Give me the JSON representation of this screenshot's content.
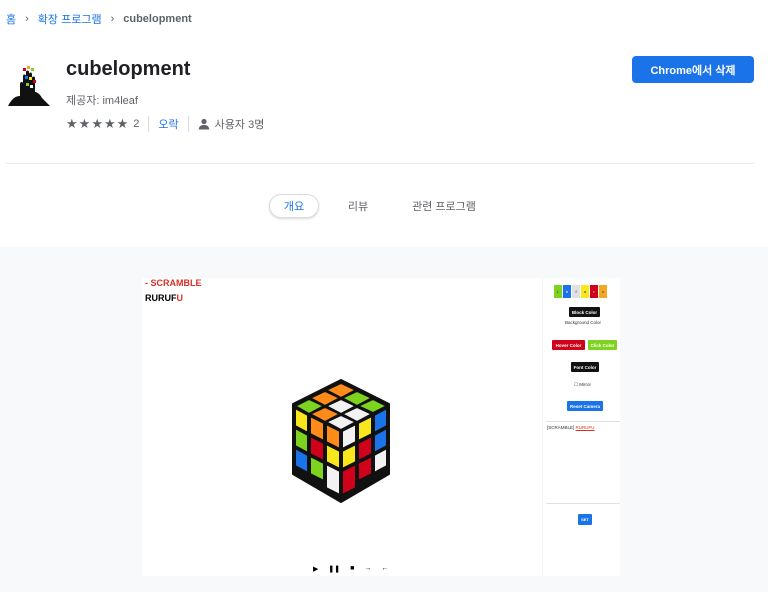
{
  "breadcrumb": {
    "home": "홈",
    "extensions": "확장 프로그램",
    "current": "cubelopment",
    "separator": "›"
  },
  "app": {
    "title": "cubelopment",
    "publisher": "제공자: im4leaf",
    "rating_stars": 5,
    "rating_count": "2",
    "category": "오락",
    "users": "사용자 3명",
    "remove_button": "Chrome에서 삭제"
  },
  "tabs": [
    {
      "label": "개요",
      "active": true
    },
    {
      "label": "리뷰",
      "active": false
    },
    {
      "label": "관련 프로그램",
      "active": false
    }
  ],
  "screenshot": {
    "scramble_title": "- SCRAMBLE",
    "moves_prefix": "RURUF",
    "moves_last": "U",
    "controls": [
      "▶",
      "❚❚",
      "■",
      "→",
      "←"
    ],
    "panel": {
      "swatches": [
        {
          "label": "L",
          "color": "#7ed321"
        },
        {
          "label": "b",
          "color": "#1a73e8"
        },
        {
          "label": "f",
          "color": "#e0e0e0"
        },
        {
          "label": "a",
          "color": "#f8e71c"
        },
        {
          "label": "r",
          "color": "#d0021b"
        },
        {
          "label": "o",
          "color": "#f5a623"
        }
      ],
      "block_color": "Block Color",
      "background_color": "Background Color",
      "hover_color": "Hover Color",
      "click_color": "Click Color",
      "font_color": "Font Color",
      "mirror": "☐ Mirror",
      "reset_camera": "Reset Camera",
      "scramble_text": "[SCRAMBLE]",
      "scramble_moves": "RURUFU",
      "set_button": "SET"
    }
  },
  "colors": {
    "accent": "#1a73e8",
    "red": "#d93025"
  }
}
